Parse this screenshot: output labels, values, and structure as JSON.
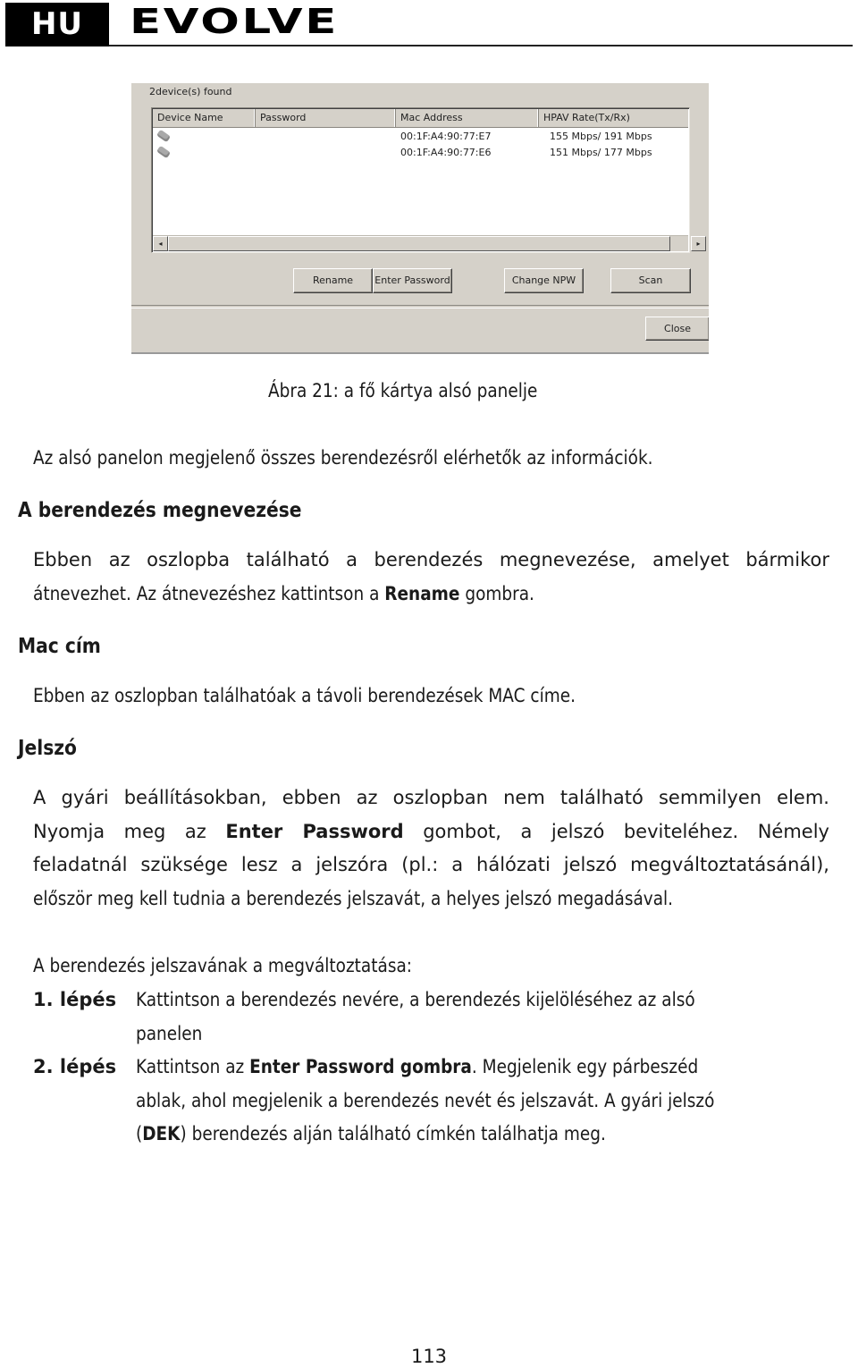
{
  "header": {
    "language_badge": "HU",
    "brand": "EVOLVE"
  },
  "app_window": {
    "status": "2device(s) found",
    "columns": [
      "Device Name",
      "Password",
      "Mac Address",
      "HPAV Rate(Tx/Rx)"
    ],
    "rows": [
      {
        "icon": "powerline-device-icon",
        "device_name": "",
        "password": "",
        "mac": "00:1F:A4:90:77:E7",
        "rate": "155 Mbps/ 191 Mbps"
      },
      {
        "icon": "powerline-device-icon",
        "device_name": "",
        "password": "",
        "mac": "00:1F:A4:90:77:E6",
        "rate": "151 Mbps/ 177 Mbps"
      }
    ],
    "scroll_left": "◂",
    "scroll_right": "▸",
    "buttons": {
      "rename": "Rename",
      "enter_password": "Enter Password",
      "change_npw": "Change NPW",
      "scan": "Scan",
      "close": "Close"
    }
  },
  "caption": "Ábra 21: a fő kártya alsó panelje",
  "intro": "Az alsó panelon megjelenő összes berendezésről elérhetők az információk.",
  "sections": {
    "device_name": {
      "heading": "A berendezés megnevezése",
      "line1": "Ebben az oszlopba található a berendezés megnevezése, amelyet bármikor",
      "line2_pre": "átnevezhet. Az átnevezéshez kattintson a ",
      "line2_bold": "Rename",
      "line2_post": " gombra."
    },
    "mac": {
      "heading": "Mac cím",
      "line1": "Ebben az oszlopban találhatóak a távoli berendezések MAC címe."
    },
    "password": {
      "heading": "Jelszó",
      "line1": "A gyári beállításokban, ebben az oszlopban nem található semmilyen elem.",
      "line2_pre": "Nyomja meg az ",
      "line2_bold": "Enter Password",
      "line2_post": " gombot, a jelszó beviteléhez. Némely",
      "line3": "feladatnál szüksége lesz a jelszóra (pl.: a hálózati jelszó megváltoztatásánál),",
      "line4": "először meg kell tudnia a berendezés jelszavát, a helyes jelszó megadásával."
    }
  },
  "procedure": {
    "title": "A berendezés jelszavának a megváltoztatása:",
    "steps": [
      {
        "label": "1. lépés",
        "line1": "Kattintson a berendezés nevére, a berendezés kijelöléséhez az alsó",
        "line2": "panelen"
      },
      {
        "label": "2. lépés",
        "line1_pre": "Kattintson az ",
        "line1_bold": "Enter Password gombra",
        "line1_post": ". Megjelenik egy párbeszéd",
        "line2": "ablak, ahol megjelenik a berendezés nevét és jelszavát. A gyári jelszó",
        "line3_pre": "(",
        "line3_bold": "DEK",
        "line3_post": ") berendezés alján található címkén találhatja meg."
      }
    ]
  },
  "page_number": "113"
}
